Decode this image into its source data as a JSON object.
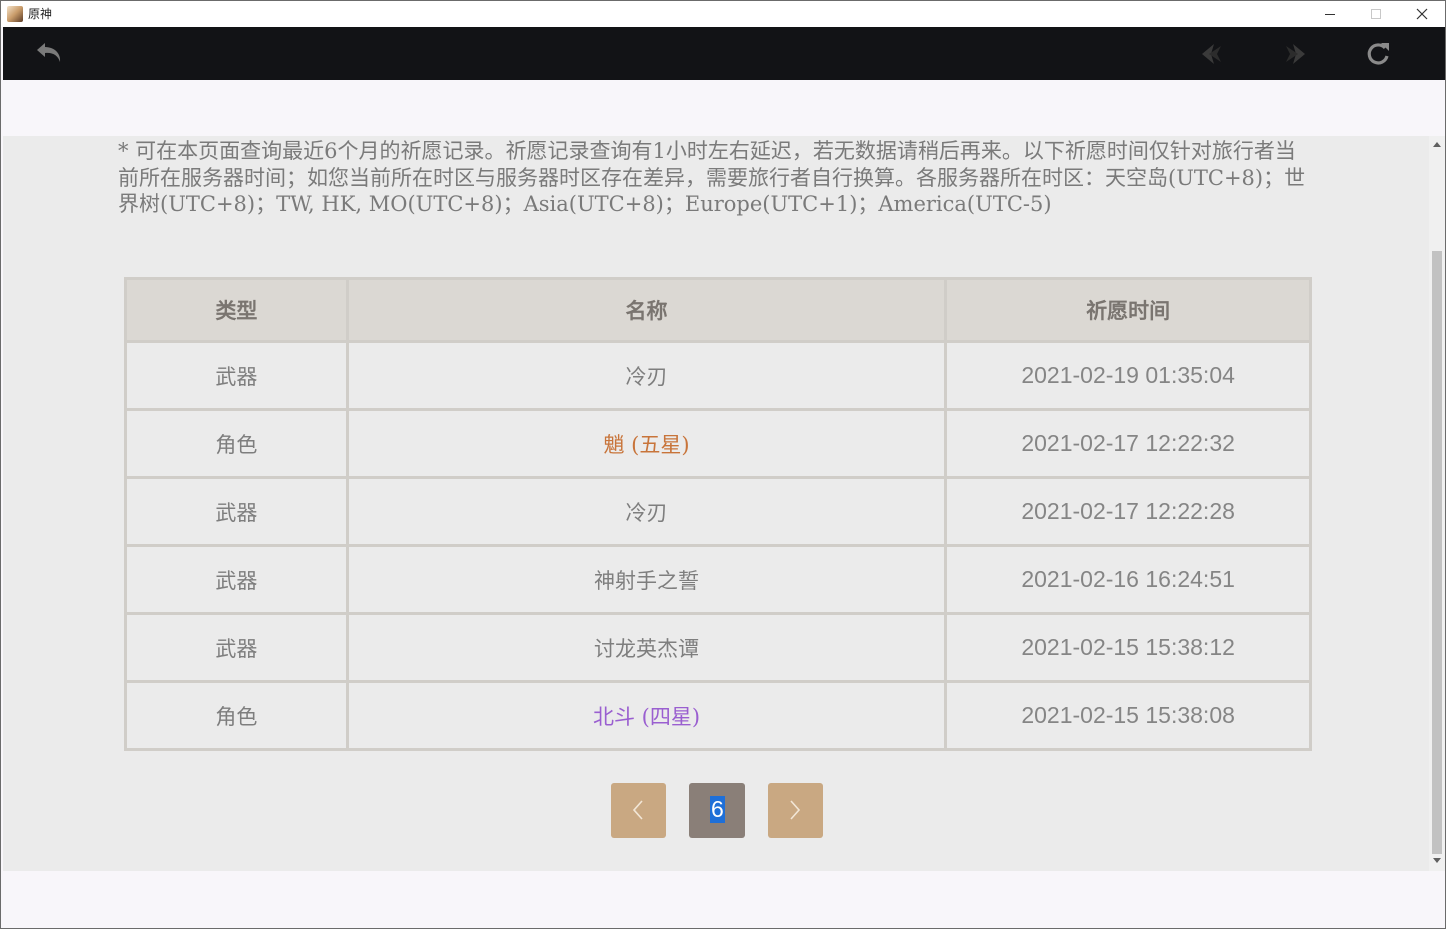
{
  "window": {
    "title": "原神"
  },
  "notice": "* 可在本页面查询最近6个月的祈愿记录。祈愿记录查询有1小时左右延迟，若无数据请稍后再来。以下祈愿时间仅针对旅行者当前所在服务器时间；如您当前所在时区与服务器时区存在差异，需要旅行者自行换算。各服务器所在时区：天空岛(UTC+8)；世界树(UTC+8)；TW, HK, MO(UTC+8)；Asia(UTC+8)；Europe(UTC+1)；America(UTC-5)",
  "table": {
    "headers": [
      "类型",
      "名称",
      "祈愿时间"
    ],
    "rows": [
      {
        "type": "武器",
        "name": "冷刃",
        "time": "2021-02-19 01:35:04",
        "name_color": "#7e7e7e"
      },
      {
        "type": "角色",
        "name": "魈 (五星)",
        "time": "2021-02-17 12:22:32",
        "name_color": "#c8743a"
      },
      {
        "type": "武器",
        "name": "冷刃",
        "time": "2021-02-17 12:22:28",
        "name_color": "#7e7e7e"
      },
      {
        "type": "武器",
        "name": "神射手之誓",
        "time": "2021-02-16 16:24:51",
        "name_color": "#7e7e7e"
      },
      {
        "type": "武器",
        "name": "讨龙英杰谭",
        "time": "2021-02-15 15:38:12",
        "name_color": "#7e7e7e"
      },
      {
        "type": "角色",
        "name": "北斗 (四星)",
        "time": "2021-02-15 15:38:08",
        "name_color": "#9a5fd0"
      }
    ]
  },
  "pagination": {
    "current_page": "6"
  },
  "icons": {
    "back": "undo-arrow-icon",
    "prev": "diamond-left-icon",
    "next": "diamond-right-icon",
    "refresh": "refresh-icon"
  },
  "colors": {
    "toolbar": "#121316",
    "pager_button": "#c9a882",
    "pager_current": "#8a7f78",
    "five_star": "#c8743a",
    "four_star": "#9a5fd0"
  }
}
